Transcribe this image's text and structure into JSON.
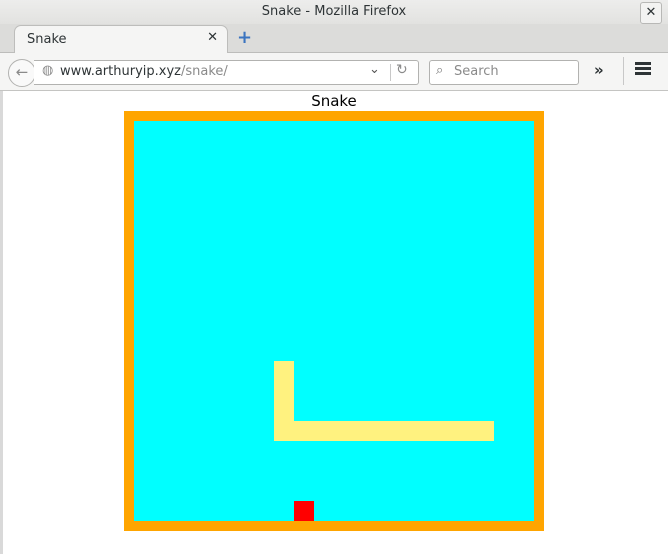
{
  "window": {
    "title": "Snake - Mozilla Firefox",
    "close_symbol": "✕"
  },
  "tabs": [
    {
      "label": "Snake",
      "close_symbol": "✕",
      "active": true
    }
  ],
  "new_tab_symbol": "+",
  "navbar": {
    "url_domain": "www.arthuryip.xyz",
    "url_path": "/snake/",
    "search_placeholder": "Search",
    "icons": [
      "back-arrow-icon",
      "globe-icon",
      "dropdown-icon",
      "reload-icon",
      "search-icon",
      "overflow-icon",
      "hamburger-menu-icon"
    ]
  },
  "page": {
    "heading": "Snake",
    "colors": {
      "border": "#ffa500",
      "background": "#00ffff",
      "snake": "#fff27f",
      "food": "#ff0000"
    },
    "grid": {
      "cells": 20,
      "snake_cells": [
        [
          7,
          12
        ],
        [
          7,
          13
        ],
        [
          7,
          14
        ],
        [
          7,
          15
        ],
        [
          8,
          15
        ],
        [
          9,
          15
        ],
        [
          10,
          15
        ],
        [
          11,
          15
        ],
        [
          12,
          15
        ],
        [
          13,
          15
        ],
        [
          14,
          15
        ],
        [
          15,
          15
        ],
        [
          16,
          15
        ],
        [
          17,
          15
        ]
      ],
      "food_cell": [
        8,
        19
      ]
    }
  }
}
